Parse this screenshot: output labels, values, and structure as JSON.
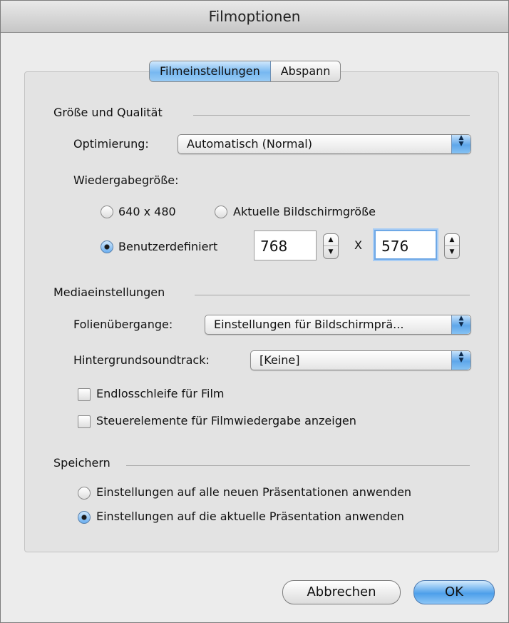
{
  "window": {
    "title": "Filmoptionen"
  },
  "tabs": [
    {
      "label": "Filmeinstellungen",
      "active": true
    },
    {
      "label": "Abspann",
      "active": false
    }
  ],
  "size_quality": {
    "title": "Größe und Qualität",
    "optimization_label": "Optimierung:",
    "optimization_value": "Automatisch (Normal)",
    "playback_size_label": "Wiedergabegröße:",
    "option_640": "640 x 480",
    "option_current": "Aktuelle Bildschirmgröße",
    "option_custom": "Benutzerdefiniert",
    "width_value": "768",
    "x_label": "X",
    "height_value": "576"
  },
  "media": {
    "title": "Mediaeinstellungen",
    "transitions_label": "Folienübergange:",
    "transitions_value": "Einstellungen für Bildschirmprä...",
    "soundtrack_label": "Hintergrundsoundtrack:",
    "soundtrack_value": "[Keine]",
    "loop_label": "Endlosschleife für Film",
    "controls_label": "Steuerelemente für Filmwiedergabe anzeigen"
  },
  "save": {
    "title": "Speichern",
    "option_all": "Einstellungen auf alle neuen Präsentationen anwenden",
    "option_current": "Einstellungen auf die aktuelle Präsentation anwenden"
  },
  "buttons": {
    "cancel": "Abbrechen",
    "ok": "OK"
  },
  "icons": {
    "popup_arrows": "▲▼",
    "stepper_up": "▲",
    "stepper_down": "▼"
  },
  "colors": {
    "accent": "#5ea6ea",
    "window_bg": "#ececec",
    "panel_bg": "#e3e3e3"
  }
}
